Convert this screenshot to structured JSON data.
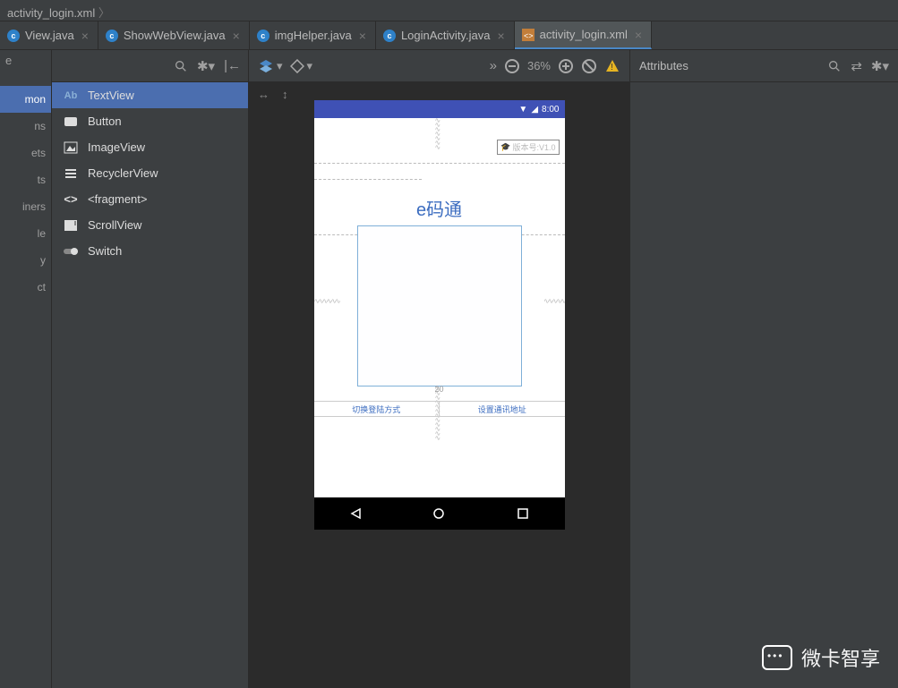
{
  "breadcrumb": "activity_login.xml",
  "tabs": [
    {
      "label": "View.java",
      "kind": "java"
    },
    {
      "label": "ShowWebView.java",
      "kind": "java"
    },
    {
      "label": "imgHelper.java",
      "kind": "java"
    },
    {
      "label": "LoginActivity.java",
      "kind": "java"
    },
    {
      "label": "activity_login.xml",
      "kind": "xml",
      "active": true
    }
  ],
  "palette_categories": [
    "e",
    "mon",
    "ns",
    "ets",
    "ts",
    "iners",
    "le",
    "y",
    "ct"
  ],
  "widgets": [
    {
      "icon": "Ab",
      "label": "TextView",
      "sel": true
    },
    {
      "icon": "btn",
      "label": "Button"
    },
    {
      "icon": "img",
      "label": "ImageView"
    },
    {
      "icon": "list",
      "label": "RecyclerView"
    },
    {
      "icon": "frag",
      "label": "<fragment>"
    },
    {
      "icon": "scroll",
      "label": "ScrollView"
    },
    {
      "icon": "switch",
      "label": "Switch"
    }
  ],
  "zoom": "36%",
  "attributes_title": "Attributes",
  "phone": {
    "time": "8:00",
    "version": "版本号:V1.0",
    "title": "e码通",
    "link1": "切换登陆方式",
    "link2": "设置通讯地址",
    "gap_label": "20"
  },
  "watermark": "微卡智享"
}
